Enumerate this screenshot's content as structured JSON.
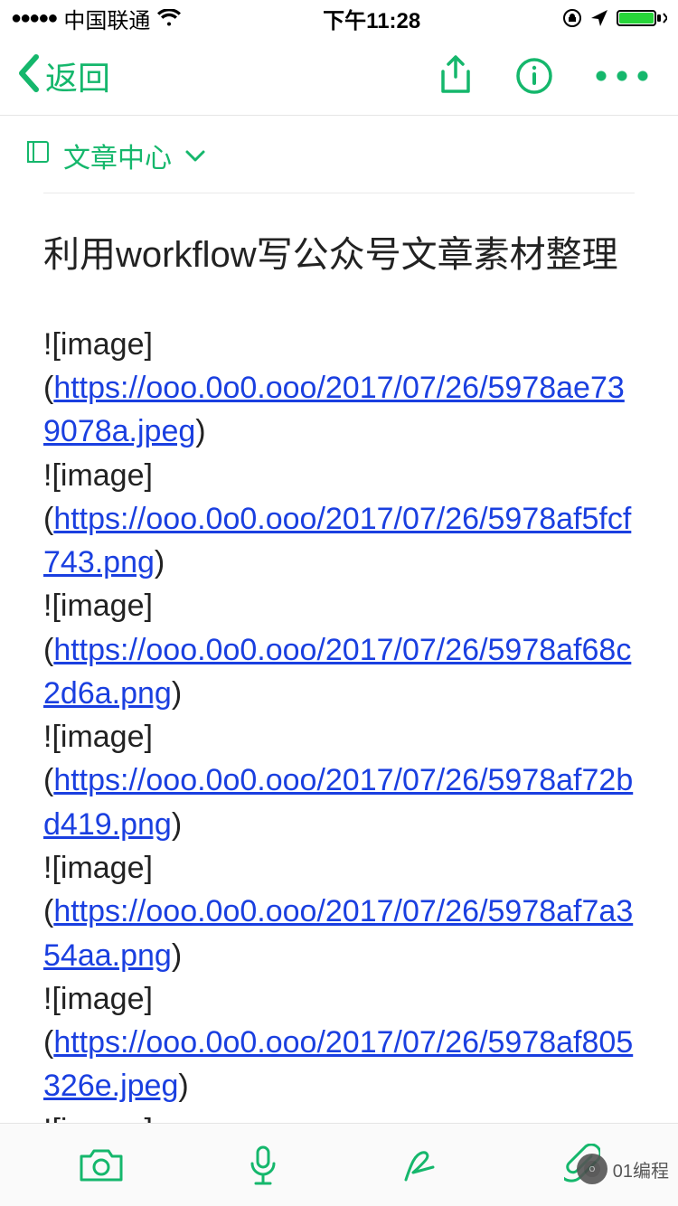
{
  "status": {
    "signal_dots": "●●●●●",
    "carrier": "中国联通",
    "time": "下午11:28"
  },
  "nav": {
    "back_label": "返回"
  },
  "notebook": {
    "label": "文章中心"
  },
  "article": {
    "title": "利用workflow写公众号文章素材整理",
    "images": [
      {
        "prefix": "![image]",
        "url": "https://ooo.0o0.ooo/2017/07/26/5978ae739078a.jpeg"
      },
      {
        "prefix": "![image]",
        "url": "https://ooo.0o0.ooo/2017/07/26/5978af5fcf743.png"
      },
      {
        "prefix": "![image]",
        "url": "https://ooo.0o0.ooo/2017/07/26/5978af68c2d6a.png"
      },
      {
        "prefix": "![image]",
        "url": "https://ooo.0o0.ooo/2017/07/26/5978af72bd419.png"
      },
      {
        "prefix": "![image]",
        "url": "https://ooo.0o0.ooo/2017/07/26/5978af7a354aa.png"
      },
      {
        "prefix": "![image]",
        "url": "https://ooo.0o0.ooo/2017/07/26/5978af805326e.jpeg"
      }
    ],
    "trailing_prefix": "![image]"
  },
  "watermark": {
    "text": "01编程"
  },
  "colors": {
    "accent": "#15b76c",
    "link": "#1a3fe0"
  }
}
